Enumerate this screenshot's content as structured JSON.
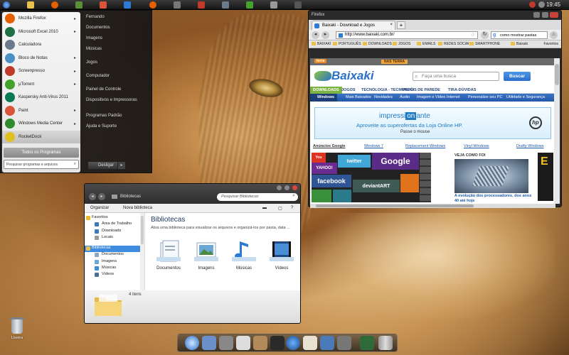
{
  "taskbar": {
    "clock": "19:45"
  },
  "start_menu": {
    "programs": [
      {
        "label": "Mozilla Firefox",
        "icon": "firefox-icon",
        "color": "#e66000",
        "has_arrow": true
      },
      {
        "label": "Microsoft Excel 2010",
        "icon": "excel-icon",
        "color": "#1e7145",
        "has_arrow": true
      },
      {
        "label": "Calculadora",
        "icon": "calculator-icon",
        "color": "#6b7b8c",
        "has_arrow": false
      },
      {
        "label": "Bloco de Notas",
        "icon": "notepad-icon",
        "color": "#4a90c4",
        "has_arrow": true
      },
      {
        "label": "Screenpresso",
        "icon": "screenpresso-icon",
        "color": "#c0392b",
        "has_arrow": true
      },
      {
        "label": "µTorrent",
        "icon": "utorrent-icon",
        "color": "#44a12b",
        "has_arrow": true
      },
      {
        "label": "Kaspersky Anti-Virus 2011",
        "icon": "kaspersky-icon",
        "color": "#0a7a55",
        "has_arrow": false
      },
      {
        "label": "Paint",
        "icon": "paint-icon",
        "color": "#d9543b",
        "has_arrow": true
      },
      {
        "label": "Windows Media Center",
        "icon": "media-center-icon",
        "color": "#2e8b2e",
        "has_arrow": true
      },
      {
        "label": "RocketDock",
        "icon": "rocketdock-icon",
        "color": "#e0c020",
        "has_arrow": false
      }
    ],
    "all_programs": "Todos os Programas",
    "search_placeholder": "Pesquisar programas e arquivos",
    "places": [
      "Fernando",
      "Documentos",
      "Imagens",
      "Músicas",
      "Jogos",
      "Computador",
      "Painel de Controle",
      "Dispositivos e Impressoras",
      "Programas Padrão",
      "Ajuda e Suporte"
    ],
    "shutdown": "Desligar"
  },
  "browser": {
    "title": "Firefox",
    "tab_label": "Baixaki - Download e Jogos",
    "url": "http://www.baixaki.com.br/",
    "search_value": "como mostrar pastas",
    "bookmarks": [
      "BAIXAKI",
      "PORTUGUÊS",
      "DOWNLOADS",
      "JOGOS",
      "EMAILS",
      "REDES SOCIAIS",
      "SMARTPHONE",
      "Baixaki"
    ],
    "favorites": "Favoritos",
    "terra_label": "terra",
    "terra_site": "NAS TERRA",
    "site": {
      "logo": "Baixaki",
      "search_placeholder": "Faça uma busca",
      "search_button": "Buscar",
      "nav": [
        "DOWNLOADS",
        "JOGOS",
        "TECNOLOGIA - TECMUNDO",
        "PAPÉIS DE PAREDE",
        "TIRA-DÚVIDAS"
      ],
      "subnav": [
        "Windows",
        "Mais Baixados",
        "Novidades",
        "Áudio",
        "Imagem e Vídeo",
        "Internet",
        "Personalize seu PC",
        "Utilidade e Segurança"
      ],
      "ad": {
        "brand_prefix": "impressi",
        "brand_mid": "on",
        "brand_suffix": "ante",
        "line2": "Aproveite as superofertas da Loja Online HP.",
        "line3": "Passe o mouse",
        "logo": "hp"
      },
      "ad_links": [
        "Anúncios Google",
        "Windows 7",
        "Replacement Windows",
        "Vinyl Windows",
        "Drafty Windows"
      ],
      "tiles": {
        "yahoo": "YAHOO!",
        "twitter": "twitter",
        "google": "Google",
        "facebook": "facebook",
        "deviantart": "deviantART"
      },
      "news": {
        "heading": "VEJA COMO FOI",
        "caption": "A evolução dos processadores, dos anos 40 até hoje"
      }
    }
  },
  "explorer": {
    "path": "Bibliotecas",
    "search_placeholder": "Pesquisar Bibliotecas",
    "commands": [
      "Organizar",
      "Nova biblioteca"
    ],
    "nav_pane": [
      {
        "label": "Favoritos",
        "header": true,
        "icon": "star-icon",
        "color": "#e8b923"
      },
      {
        "label": "Área de Trabalho",
        "header": false,
        "icon": "desktop-icon",
        "color": "#3a78c2"
      },
      {
        "label": "Downloads",
        "header": false,
        "icon": "downloads-icon",
        "color": "#3a78c2"
      },
      {
        "label": "Locais",
        "header": false,
        "icon": "places-icon",
        "color": "#9a9a9a"
      },
      {
        "label": "Bibliotecas",
        "header": true,
        "selected": true,
        "icon": "libraries-icon",
        "color": "#e8c14c"
      },
      {
        "label": "Documentos",
        "header": false,
        "icon": "documents-icon",
        "color": "#8fa6c2"
      },
      {
        "label": "Imagens",
        "header": false,
        "icon": "pictures-icon",
        "color": "#6aa6d6"
      },
      {
        "label": "Músicas",
        "header": false,
        "icon": "music-icon",
        "color": "#3a8ed6"
      },
      {
        "label": "Vídeos",
        "header": false,
        "icon": "videos-icon",
        "color": "#4a6e9a"
      }
    ],
    "heading": "Bibliotecas",
    "description": "Abra uma biblioteca para visualizar os arquivos e organizá-los por pasta, data ...",
    "libraries": [
      {
        "label": "Documentos",
        "icon": "documents-library-icon"
      },
      {
        "label": "Imagens",
        "icon": "pictures-library-icon"
      },
      {
        "label": "Músicas",
        "icon": "music-library-icon"
      },
      {
        "label": "Vídeos",
        "icon": "videos-library-icon"
      }
    ],
    "item_count": "4 itens"
  },
  "desktop": {
    "recycle_bin": "Lixeira"
  }
}
